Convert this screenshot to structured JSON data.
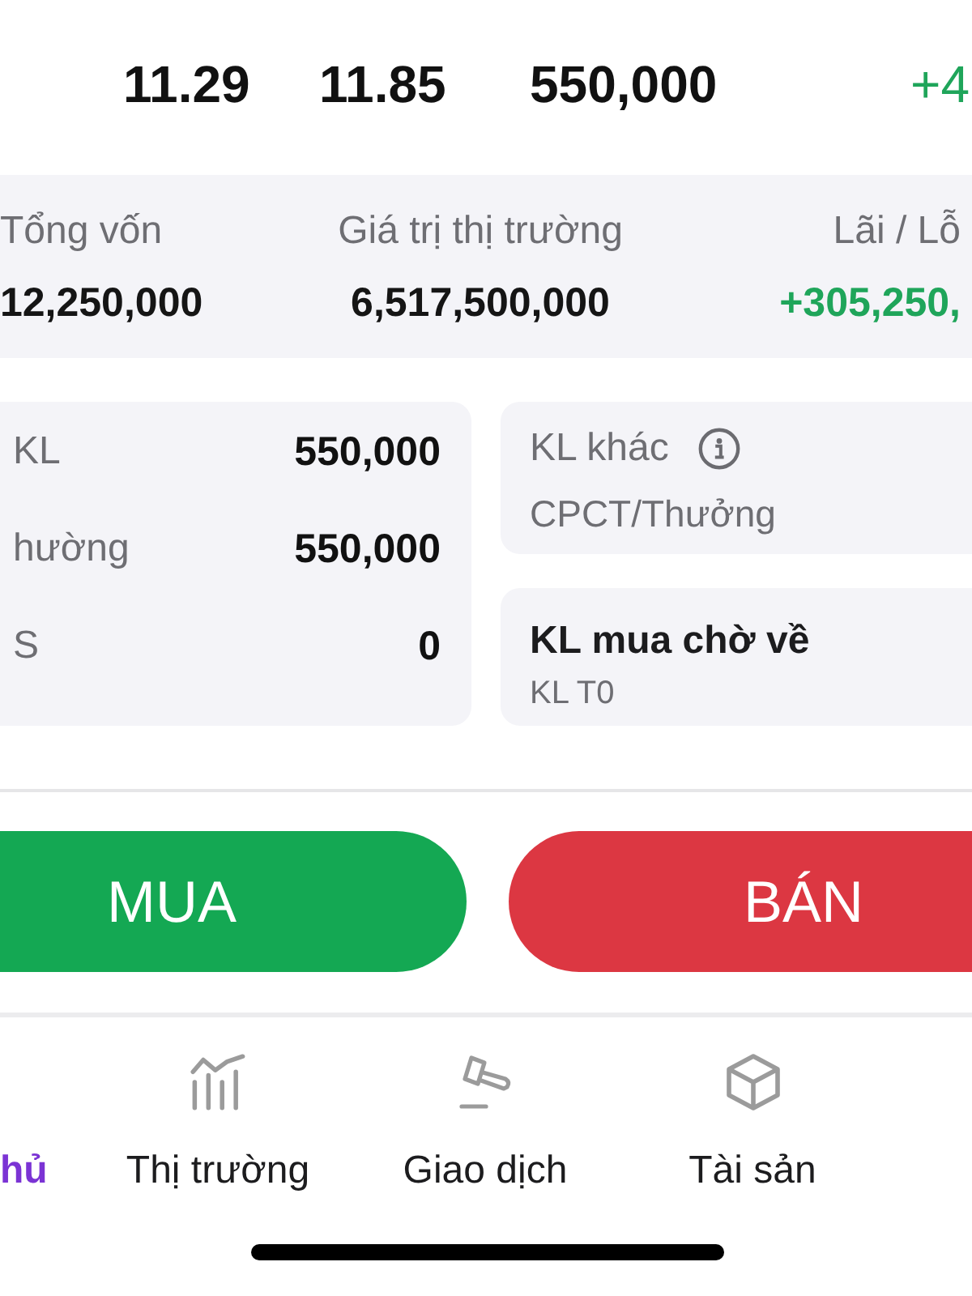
{
  "price_row": {
    "cells": [
      "11.29",
      "11.85",
      "550,000"
    ],
    "change": "+4"
  },
  "summary": [
    {
      "label": "Tổng vốn",
      "value": "12,250,000",
      "kind": "plain"
    },
    {
      "label": "Giá trị thị trường",
      "value": "6,517,500,000",
      "kind": "plain"
    },
    {
      "label": "Lãi / Lỗ",
      "value": "+305,250,",
      "kind": "gain"
    }
  ],
  "holdings": [
    {
      "label": "KL",
      "value": "550,000"
    },
    {
      "label": "hường",
      "value": "550,000"
    },
    {
      "label": "S",
      "value": "0"
    }
  ],
  "other_volume": {
    "title": "KL khác",
    "subtitle": "CPCT/Thưởng"
  },
  "pending_buy": {
    "title": "KL mua chờ về",
    "subtitle": "KL T0"
  },
  "actions": [
    {
      "label": "MUA",
      "kind": "buy"
    },
    {
      "label": "BÁN",
      "kind": "sell"
    }
  ],
  "tab_bar": [
    {
      "label": "hủ",
      "selected": true
    },
    {
      "label": "Thị trường",
      "selected": false
    },
    {
      "label": "Giao dịch",
      "selected": false
    },
    {
      "label": "Tài sản",
      "selected": false
    }
  ]
}
